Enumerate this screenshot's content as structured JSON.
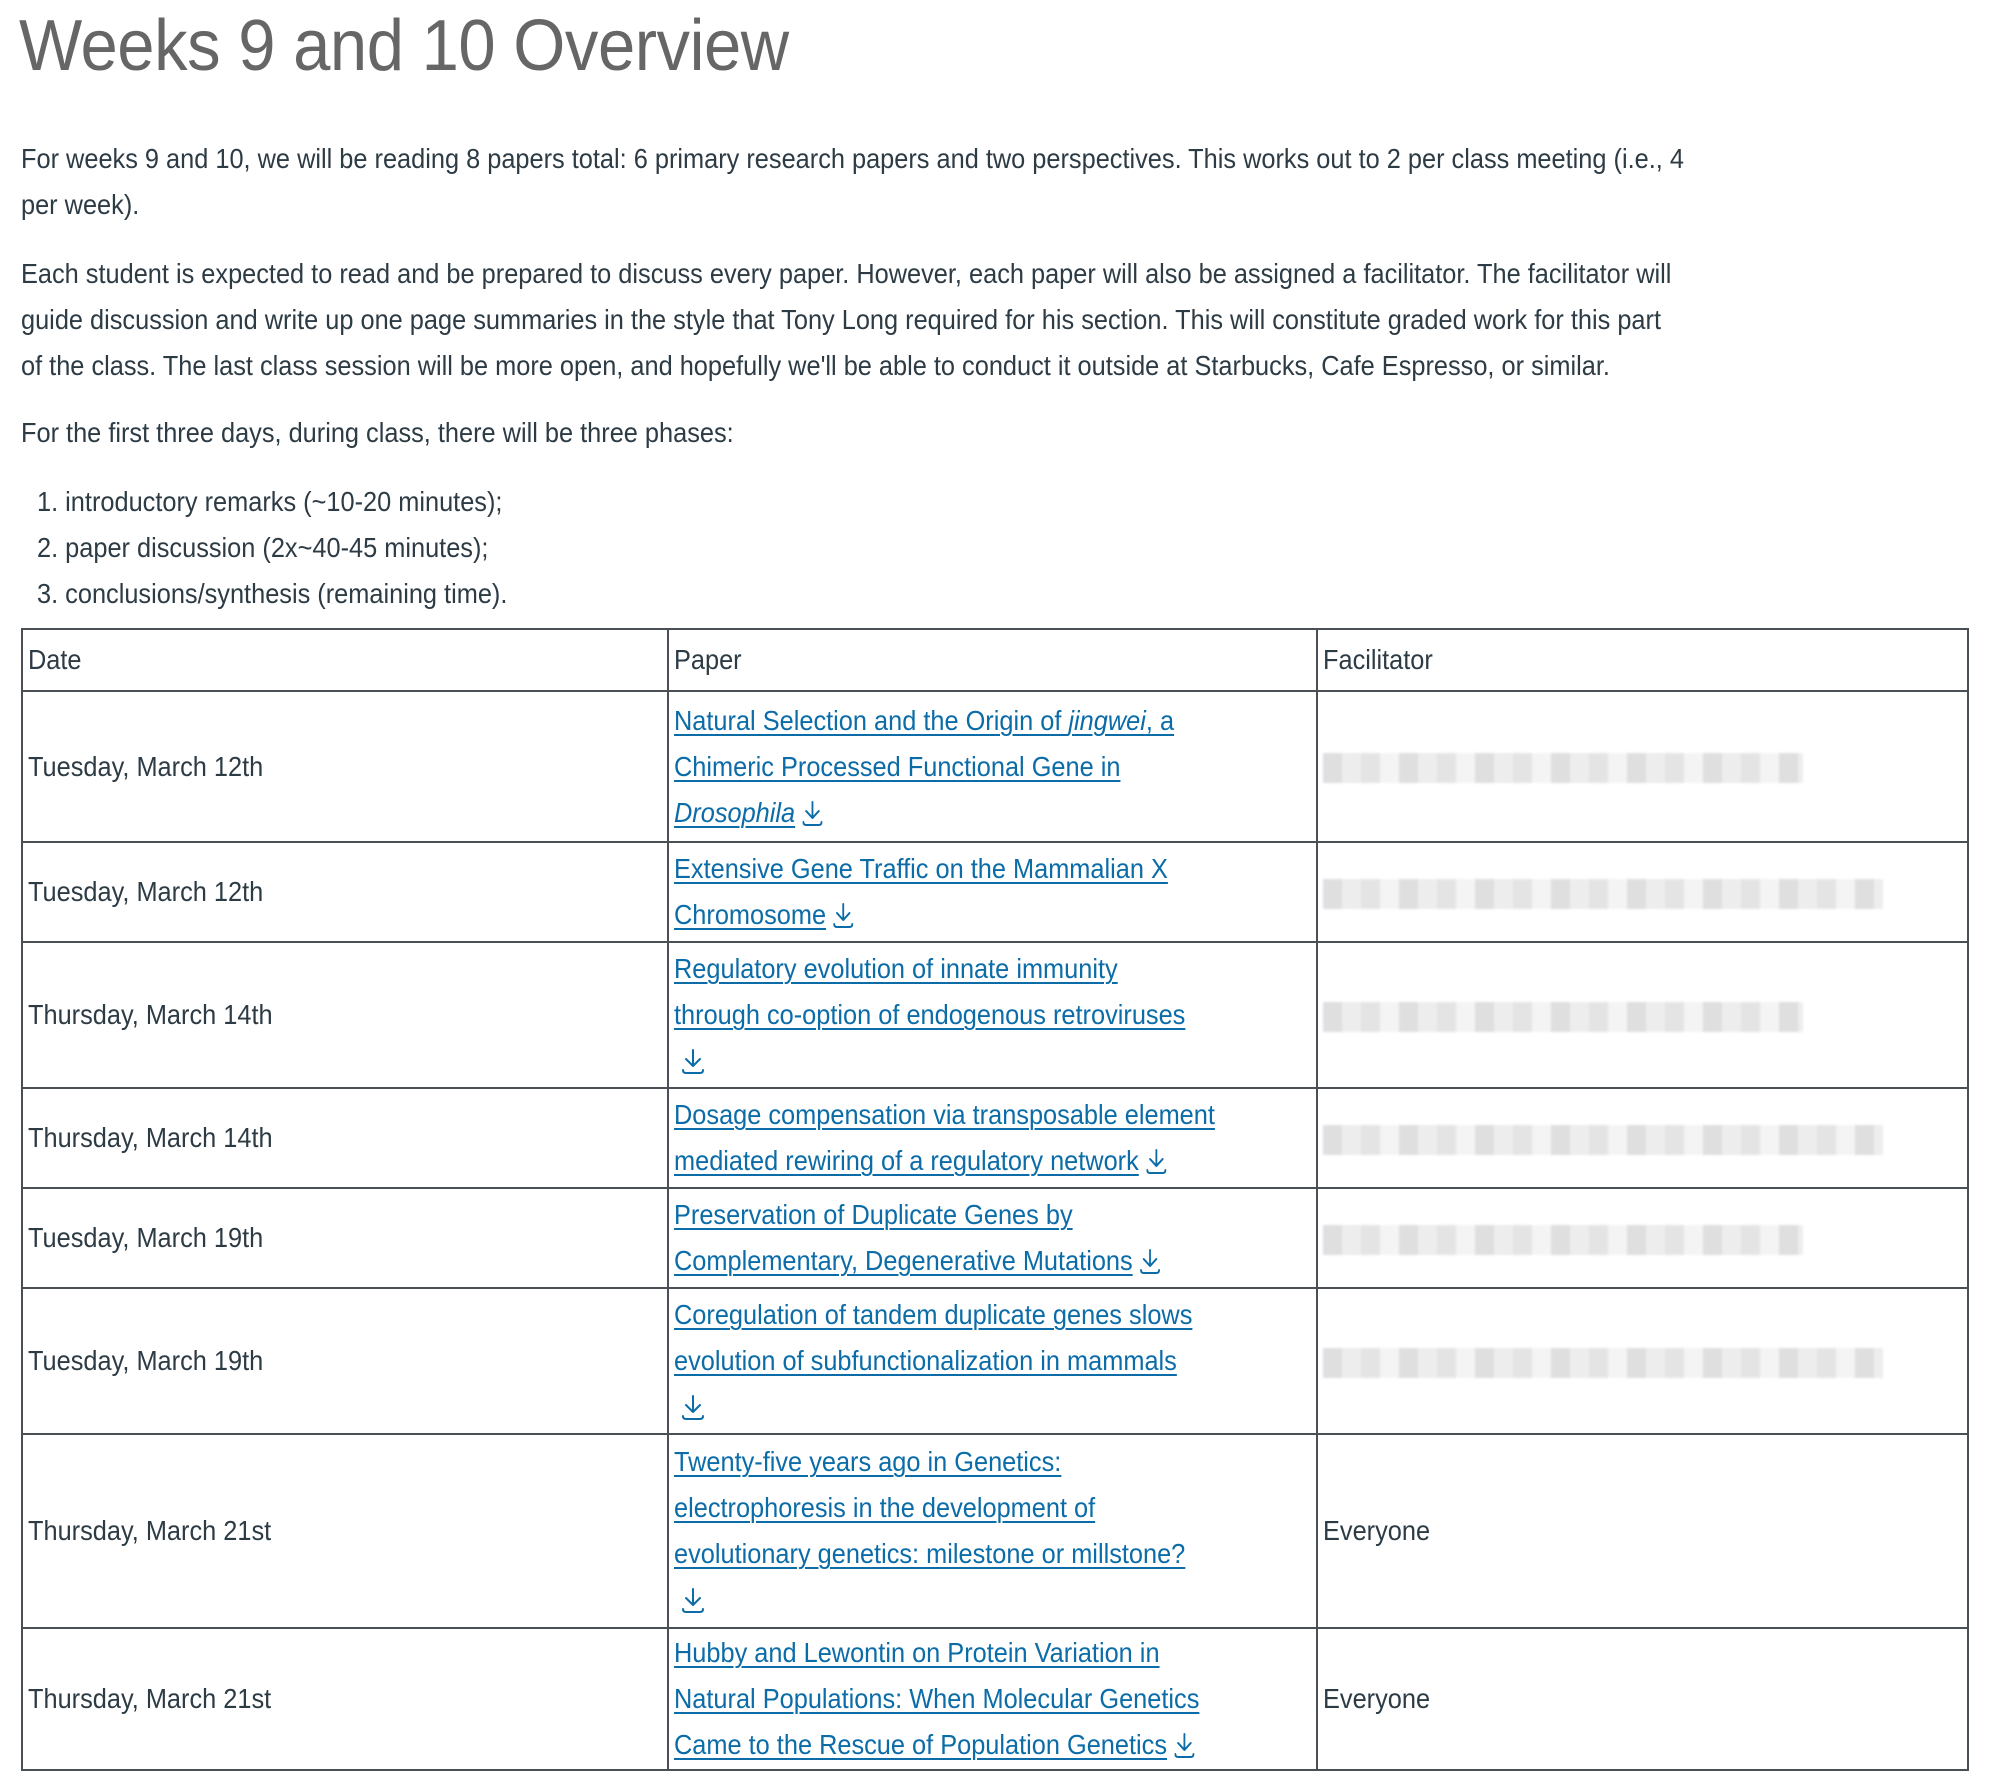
{
  "title": "Weeks 9 and 10 Overview",
  "paragraphs": {
    "p1": [
      "For weeks 9 and 10, we will be reading 8 papers total: 6 primary research papers and two perspectives. This works out to 2 per class meeting (i.e., 4",
      "per week)."
    ],
    "p2": [
      "Each student is expected to read and be prepared to discuss every paper. However, each paper will also be assigned a facilitator. The facilitator will",
      "guide discussion and write up one page summaries in the style that Tony Long required for his section. This will constitute graded work for this part",
      "of the class. The last class session will be more open, and hopefully we'll be able to conduct it outside at Starbucks, Cafe Espresso, or similar."
    ],
    "p3": [
      "For the first three days, during class, there will be three phases:"
    ]
  },
  "phases": [
    {
      "num": "1.",
      "text": "introductory remarks (~10-20 minutes);"
    },
    {
      "num": "2.",
      "text": "paper discussion (2x~40-45 minutes);"
    },
    {
      "num": "3.",
      "text": "conclusions/synthesis (remaining time)."
    }
  ],
  "table": {
    "headers": [
      "Date",
      "Paper",
      "Facilitator"
    ],
    "rows": [
      {
        "date": "Tuesday, March 12th",
        "paper_lines": [
          "Natural Selection and the Origin of |jingwei|, a",
          "Chimeric Processed Functional Gene in",
          "|Drosophila|"
        ],
        "facilitator": "[redacted]",
        "icon": "download-icon"
      },
      {
        "date": "Tuesday, March 12th",
        "paper_lines": [
          "Extensive Gene Traffic on the Mammalian X",
          "Chromosome"
        ],
        "facilitator": "[redacted]",
        "icon": "download-icon"
      },
      {
        "date": "Thursday, March 14th",
        "paper_lines": [
          "Regulatory evolution of innate immunity",
          "through co-option of endogenous retroviruses"
        ],
        "facilitator": "[redacted]",
        "icon": "download-icon",
        "icon_own_line": true
      },
      {
        "date": "Thursday, March 14th",
        "paper_lines": [
          "Dosage compensation via transposable element",
          "mediated rewiring of a regulatory network"
        ],
        "facilitator": "[redacted]",
        "icon": "download-icon"
      },
      {
        "date": "Tuesday, March 19th",
        "paper_lines": [
          "Preservation of Duplicate Genes by",
          "Complementary, Degenerative Mutations"
        ],
        "facilitator": "[redacted]",
        "icon": "download-icon"
      },
      {
        "date": "Tuesday, March 19th",
        "paper_lines": [
          "Coregulation of tandem duplicate genes slows",
          "evolution of subfunctionalization in mammals"
        ],
        "facilitator": "[redacted]",
        "icon": "download-icon",
        "icon_own_line": true
      },
      {
        "date": "Thursday, March 21st",
        "paper_lines": [
          "Twenty-five years ago in Genetics:",
          "electrophoresis in the development of",
          "evolutionary genetics: milestone or millstone?"
        ],
        "facilitator": "Everyone",
        "icon": "download-icon",
        "icon_own_line": true
      },
      {
        "date": "Thursday, March 21st",
        "paper_lines": [
          "Hubby and Lewontin on Protein Variation in",
          "Natural Populations: When Molecular Genetics",
          "Came to the Rescue of Population Genetics"
        ],
        "facilitator": "Everyone",
        "icon": "download-icon"
      }
    ]
  },
  "colors": {
    "link": "#0b6ca8",
    "text": "#2d3b45",
    "title": "#666666",
    "border": "#4a4f55"
  }
}
